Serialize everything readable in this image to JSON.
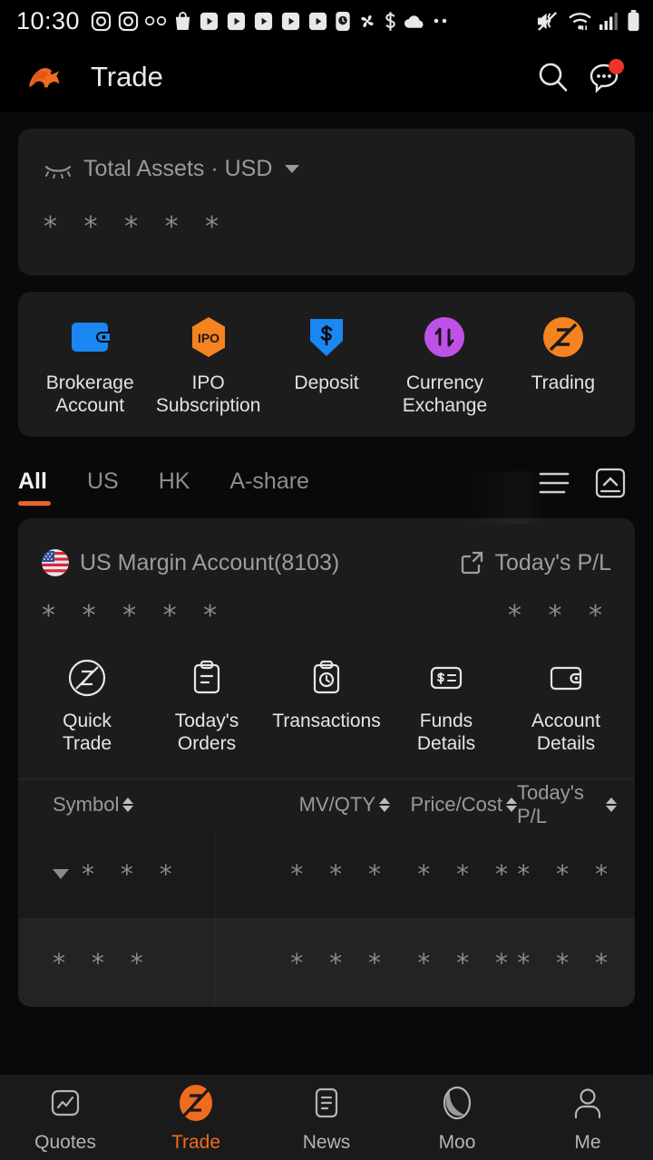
{
  "status_bar": {
    "time": "10:30",
    "left_icons": [
      "instagram-icon",
      "instagram-icon",
      "voicemail-icon",
      "shopping-bag-icon",
      "play-video-icon",
      "play-video-icon",
      "play-video-icon",
      "play-video-icon",
      "play-video-icon",
      "clock-app-icon",
      "pinwheel-icon",
      "dollar-icon",
      "cloud-icon",
      "more-dots-icon"
    ],
    "right_icons": [
      "mute-vibrate-icon",
      "wifi-icon",
      "cellular-signal-icon",
      "battery-icon"
    ]
  },
  "header": {
    "logo": "moomoo-bull-logo",
    "title": "Trade",
    "search_icon": "search-icon",
    "chat_icon": "chat-bubble-icon",
    "has_notification_badge": true
  },
  "assets_card": {
    "eye_icon": "eye-hidden-icon",
    "label": "Total Assets · USD",
    "caret_icon": "chevron-down-icon",
    "value_masked": "* * * * *"
  },
  "quick_actions": [
    {
      "icon": "wallet-icon",
      "label": "Brokerage\nAccount",
      "label_l1": "Brokerage",
      "label_l2": "Account",
      "color": "#1b87f2"
    },
    {
      "icon": "ipo-hexagon-icon",
      "label": "IPO\nSubscription",
      "label_l1": "IPO",
      "label_l2": "Subscription",
      "color": "#f5831f"
    },
    {
      "icon": "deposit-shield-icon",
      "label": "Deposit",
      "label_l1": "Deposit",
      "label_l2": "",
      "color": "#1b87f2"
    },
    {
      "icon": "currency-exchange-icon",
      "label": "Currency\nExchange",
      "label_l1": "Currency",
      "label_l2": "Exchange",
      "color": "#c051e8"
    },
    {
      "icon": "trading-z-icon",
      "label": "Trading",
      "label_l1": "Trading",
      "label_l2": "",
      "color": "#f5831f"
    }
  ],
  "market_tabs": {
    "items": [
      {
        "label": "All",
        "active": true
      },
      {
        "label": "US",
        "active": false
      },
      {
        "label": "HK",
        "active": false
      },
      {
        "label": "A-share",
        "active": false
      }
    ],
    "active_color": "#e8622c",
    "list_icon": "list-view-icon",
    "collapse_icon": "collapse-all-icon"
  },
  "account_card": {
    "flag_icon": "us-flag-icon",
    "account_name": "US Margin Account(8103)",
    "pl_link_icon": "external-link-icon",
    "pl_link_label": "Today's P/L",
    "balance_masked": "* * * * *",
    "pl_masked": "* * *",
    "actions": [
      {
        "icon": "quick-trade-icon",
        "label_l1": "Quick",
        "label_l2": "Trade"
      },
      {
        "icon": "clipboard-icon",
        "label_l1": "Today's",
        "label_l2": "Orders"
      },
      {
        "icon": "clipboard-clock-icon",
        "label_l1": "Transactions",
        "label_l2": ""
      },
      {
        "icon": "funds-dollar-icon",
        "label_l1": "Funds",
        "label_l2": "Details"
      },
      {
        "icon": "account-wallet-icon",
        "label_l1": "Account",
        "label_l2": "Details"
      }
    ],
    "table": {
      "columns": [
        {
          "label": "Symbol",
          "sortable": true
        },
        {
          "label": "MV/QTY",
          "sortable": true
        },
        {
          "label": "Price/Cost",
          "sortable": true
        },
        {
          "label": "Today's P/L",
          "sortable": true
        }
      ],
      "rows": [
        {
          "expander_icon": "triangle-down-icon",
          "symbol": "* * *",
          "mv_qty": "* * *",
          "price_cost": "* * *",
          "todays_pl": "* * *"
        },
        {
          "expander_icon": "",
          "symbol": "* * *",
          "mv_qty": "* * *",
          "price_cost": "* * *",
          "todays_pl": "* * *"
        }
      ]
    }
  },
  "bottom_nav": {
    "items": [
      {
        "icon": "quotes-chart-icon",
        "label": "Quotes",
        "active": false
      },
      {
        "icon": "trade-z-icon",
        "label": "Trade",
        "active": true
      },
      {
        "icon": "news-document-icon",
        "label": "News",
        "active": false
      },
      {
        "icon": "moo-community-icon",
        "label": "Moo",
        "active": false
      },
      {
        "icon": "profile-person-icon",
        "label": "Me",
        "active": false
      }
    ],
    "active_color": "#ef6c1f"
  }
}
